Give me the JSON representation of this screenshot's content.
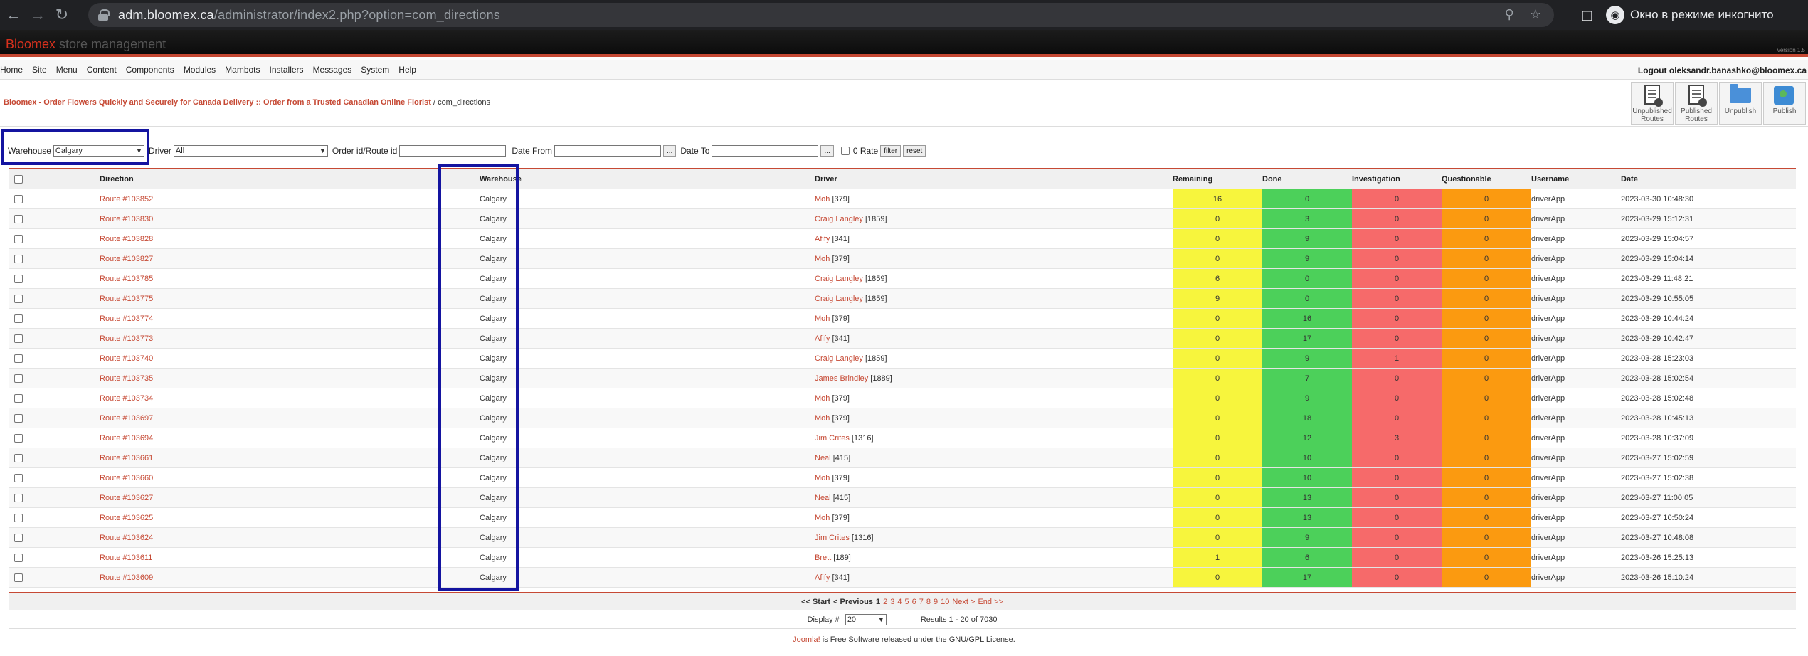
{
  "browser": {
    "url_domain": "adm.bloomex.ca",
    "url_path": "/administrator/index2.php?option=com_directions",
    "incognito_label": "Окно в режиме инкогнито"
  },
  "header": {
    "brand": "Bloomex",
    "subtitle": "store management",
    "version": "version 1.5"
  },
  "menu": {
    "items": [
      "Home",
      "Site",
      "Menu",
      "Content",
      "Components",
      "Modules",
      "Mambots",
      "Installers",
      "Messages",
      "System",
      "Help"
    ],
    "logout": "Logout oleksandr.banashko@bloomex.ca"
  },
  "breadcrumb": {
    "site": "Bloomex - Order Flowers Quickly and Securely for Canada Delivery :: Order from a Trusted Canadian Online Florist",
    "separator": " / ",
    "component": "com_directions"
  },
  "toolbar": [
    {
      "label": "Unpublished Routes",
      "icon": "document-icon"
    },
    {
      "label": "Published Routes",
      "icon": "document-icon"
    },
    {
      "label": "Unpublish",
      "icon": "folder-icon"
    },
    {
      "label": "Publish",
      "icon": "publish-icon"
    }
  ],
  "filter": {
    "warehouse_label": "Warehouse",
    "warehouse_value": "Calgary",
    "driver_label": "Driver",
    "driver_value": "All",
    "order_label": "Order id/Route id",
    "date_from_label": "Date From",
    "date_to_label": "Date To",
    "picker_label": "...",
    "zero_rate_label": "0 Rate",
    "filter_btn": "filter",
    "reset_btn": "reset"
  },
  "table": {
    "headers": [
      "Direction",
      "Warehouse",
      "Driver",
      "Remaining",
      "Done",
      "Investigation",
      "Questionable",
      "Username",
      "Date"
    ],
    "rows": [
      {
        "direction": "Route #103852",
        "warehouse": "Calgary",
        "driver_name": "Moh",
        "driver_id": "[379]",
        "remaining": "16",
        "done": "0",
        "investigation": "0",
        "questionable": "0",
        "username": "driverApp",
        "date": "2023-03-30 10:48:30"
      },
      {
        "direction": "Route #103830",
        "warehouse": "Calgary",
        "driver_name": "Craig Langley",
        "driver_id": "[1859]",
        "remaining": "0",
        "done": "3",
        "investigation": "0",
        "questionable": "0",
        "username": "driverApp",
        "date": "2023-03-29 15:12:31"
      },
      {
        "direction": "Route #103828",
        "warehouse": "Calgary",
        "driver_name": "Afify",
        "driver_id": "[341]",
        "remaining": "0",
        "done": "9",
        "investigation": "0",
        "questionable": "0",
        "username": "driverApp",
        "date": "2023-03-29 15:04:57"
      },
      {
        "direction": "Route #103827",
        "warehouse": "Calgary",
        "driver_name": "Moh",
        "driver_id": "[379]",
        "remaining": "0",
        "done": "9",
        "investigation": "0",
        "questionable": "0",
        "username": "driverApp",
        "date": "2023-03-29 15:04:14"
      },
      {
        "direction": "Route #103785",
        "warehouse": "Calgary",
        "driver_name": "Craig Langley",
        "driver_id": "[1859]",
        "remaining": "6",
        "done": "0",
        "investigation": "0",
        "questionable": "0",
        "username": "driverApp",
        "date": "2023-03-29 11:48:21"
      },
      {
        "direction": "Route #103775",
        "warehouse": "Calgary",
        "driver_name": "Craig Langley",
        "driver_id": "[1859]",
        "remaining": "9",
        "done": "0",
        "investigation": "0",
        "questionable": "0",
        "username": "driverApp",
        "date": "2023-03-29 10:55:05"
      },
      {
        "direction": "Route #103774",
        "warehouse": "Calgary",
        "driver_name": "Moh",
        "driver_id": "[379]",
        "remaining": "0",
        "done": "16",
        "investigation": "0",
        "questionable": "0",
        "username": "driverApp",
        "date": "2023-03-29 10:44:24"
      },
      {
        "direction": "Route #103773",
        "warehouse": "Calgary",
        "driver_name": "Afify",
        "driver_id": "[341]",
        "remaining": "0",
        "done": "17",
        "investigation": "0",
        "questionable": "0",
        "username": "driverApp",
        "date": "2023-03-29 10:42:47"
      },
      {
        "direction": "Route #103740",
        "warehouse": "Calgary",
        "driver_name": "Craig Langley",
        "driver_id": "[1859]",
        "remaining": "0",
        "done": "9",
        "investigation": "1",
        "questionable": "0",
        "username": "driverApp",
        "date": "2023-03-28 15:23:03"
      },
      {
        "direction": "Route #103735",
        "warehouse": "Calgary",
        "driver_name": "James Brindley",
        "driver_id": "[1889]",
        "remaining": "0",
        "done": "7",
        "investigation": "0",
        "questionable": "0",
        "username": "driverApp",
        "date": "2023-03-28 15:02:54"
      },
      {
        "direction": "Route #103734",
        "warehouse": "Calgary",
        "driver_name": "Moh",
        "driver_id": "[379]",
        "remaining": "0",
        "done": "9",
        "investigation": "0",
        "questionable": "0",
        "username": "driverApp",
        "date": "2023-03-28 15:02:48"
      },
      {
        "direction": "Route #103697",
        "warehouse": "Calgary",
        "driver_name": "Moh",
        "driver_id": "[379]",
        "remaining": "0",
        "done": "18",
        "investigation": "0",
        "questionable": "0",
        "username": "driverApp",
        "date": "2023-03-28 10:45:13"
      },
      {
        "direction": "Route #103694",
        "warehouse": "Calgary",
        "driver_name": "Jim Crites",
        "driver_id": "[1316]",
        "remaining": "0",
        "done": "12",
        "investigation": "3",
        "questionable": "0",
        "username": "driverApp",
        "date": "2023-03-28 10:37:09"
      },
      {
        "direction": "Route #103661",
        "warehouse": "Calgary",
        "driver_name": "Neal",
        "driver_id": "[415]",
        "remaining": "0",
        "done": "10",
        "investigation": "0",
        "questionable": "0",
        "username": "driverApp",
        "date": "2023-03-27 15:02:59"
      },
      {
        "direction": "Route #103660",
        "warehouse": "Calgary",
        "driver_name": "Moh",
        "driver_id": "[379]",
        "remaining": "0",
        "done": "10",
        "investigation": "0",
        "questionable": "0",
        "username": "driverApp",
        "date": "2023-03-27 15:02:38"
      },
      {
        "direction": "Route #103627",
        "warehouse": "Calgary",
        "driver_name": "Neal",
        "driver_id": "[415]",
        "remaining": "0",
        "done": "13",
        "investigation": "0",
        "questionable": "0",
        "username": "driverApp",
        "date": "2023-03-27 11:00:05"
      },
      {
        "direction": "Route #103625",
        "warehouse": "Calgary",
        "driver_name": "Moh",
        "driver_id": "[379]",
        "remaining": "0",
        "done": "13",
        "investigation": "0",
        "questionable": "0",
        "username": "driverApp",
        "date": "2023-03-27 10:50:24"
      },
      {
        "direction": "Route #103624",
        "warehouse": "Calgary",
        "driver_name": "Jim Crites",
        "driver_id": "[1316]",
        "remaining": "0",
        "done": "9",
        "investigation": "0",
        "questionable": "0",
        "username": "driverApp",
        "date": "2023-03-27 10:48:08"
      },
      {
        "direction": "Route #103611",
        "warehouse": "Calgary",
        "driver_name": "Brett",
        "driver_id": "[189]",
        "remaining": "1",
        "done": "6",
        "investigation": "0",
        "questionable": "0",
        "username": "driverApp",
        "date": "2023-03-26 15:25:13"
      },
      {
        "direction": "Route #103609",
        "warehouse": "Calgary",
        "driver_name": "Afify",
        "driver_id": "[341]",
        "remaining": "0",
        "done": "17",
        "investigation": "0",
        "questionable": "0",
        "username": "driverApp",
        "date": "2023-03-26 15:10:24"
      }
    ]
  },
  "pagination": {
    "start": "<< Start",
    "previous": "< Previous",
    "current": "1",
    "pages": [
      "2",
      "3",
      "4",
      "5",
      "6",
      "7",
      "8",
      "9",
      "10"
    ],
    "next": "Next >",
    "end": "End >>"
  },
  "display": {
    "label": "Display #",
    "value": "20",
    "results": "Results 1 - 20 of 7030"
  },
  "footer": {
    "link": "Joomla!",
    "text": " is Free Software released under the GNU/GPL License."
  },
  "colors": {
    "accent": "#c64934",
    "remaining": "#f7f53d",
    "done": "#4cd05a",
    "investigation": "#f66a6a",
    "questionable": "#fb9a10",
    "highlight": "#1414a0"
  }
}
